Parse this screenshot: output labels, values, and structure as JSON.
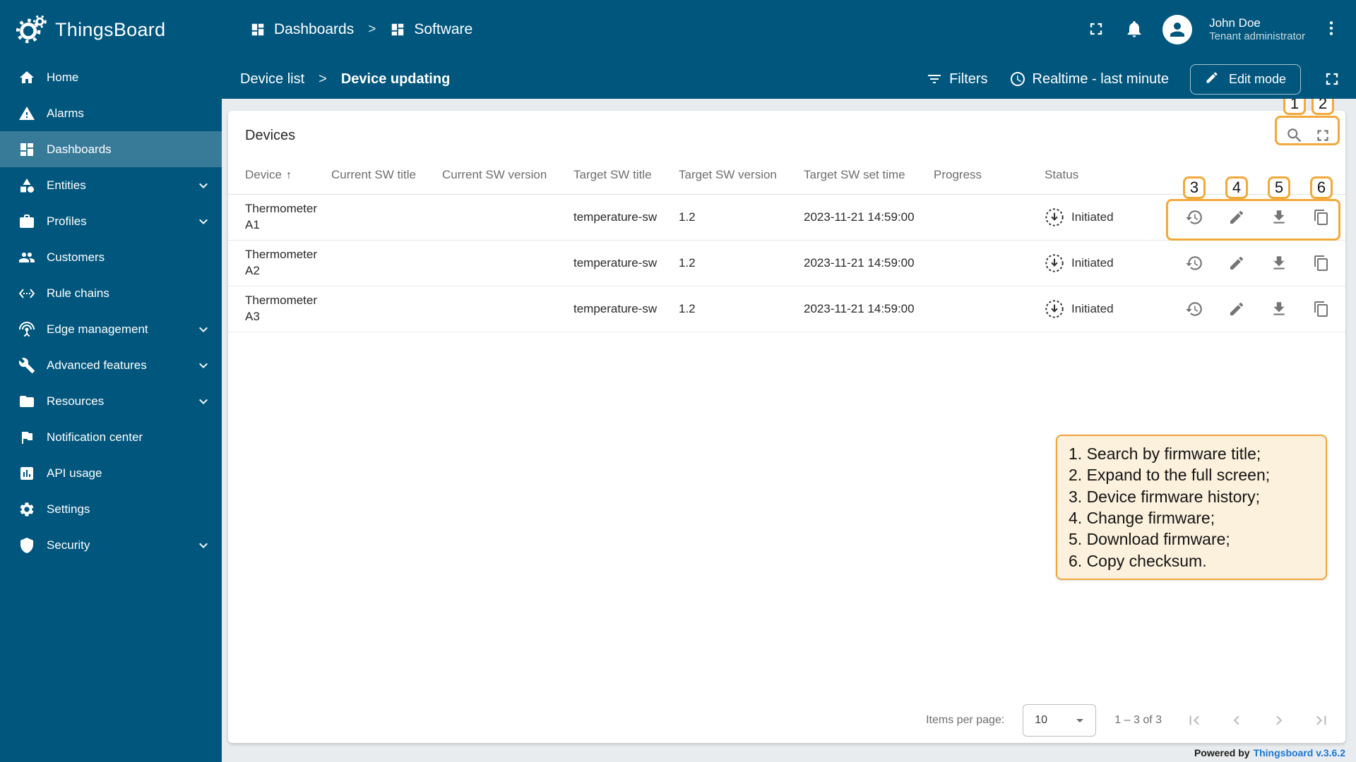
{
  "colors": {
    "primary": "#00567d",
    "annotation_orange": "#f2a93b",
    "legend_bg": "#fcf1dc",
    "link_blue": "#1976d2"
  },
  "brand": {
    "name": "ThingsBoard"
  },
  "topbar": {
    "breadcrumb": [
      {
        "label": "Dashboards"
      },
      {
        "label": "Software"
      }
    ],
    "separator": ">",
    "user": {
      "name": "John Doe",
      "role": "Tenant administrator"
    }
  },
  "sidebar": {
    "items": [
      {
        "label": "Home"
      },
      {
        "label": "Alarms"
      },
      {
        "label": "Dashboards"
      },
      {
        "label": "Entities"
      },
      {
        "label": "Profiles"
      },
      {
        "label": "Customers"
      },
      {
        "label": "Rule chains"
      },
      {
        "label": "Edge management"
      },
      {
        "label": "Advanced features"
      },
      {
        "label": "Resources"
      },
      {
        "label": "Notification center"
      },
      {
        "label": "API usage"
      },
      {
        "label": "Settings"
      },
      {
        "label": "Security"
      }
    ]
  },
  "toolbar": {
    "breadcrumb_root": "Device list",
    "separator": ">",
    "breadcrumb_current": "Device updating",
    "filters_label": "Filters",
    "realtime_label": "Realtime - last minute",
    "edit_mode_label": "Edit mode"
  },
  "devices": {
    "title": "Devices",
    "columns": {
      "device": "Device",
      "current_sw_title": "Current SW title",
      "current_sw_version": "Current SW version",
      "target_sw_title": "Target SW title",
      "target_sw_version": "Target SW version",
      "target_sw_set_time": "Target SW set time",
      "progress": "Progress",
      "status": "Status"
    },
    "sort_arrow": "↑",
    "rows": [
      {
        "device": "Thermometer A1",
        "current_sw_title": "",
        "current_sw_version": "",
        "target_sw_title": "temperature-sw",
        "target_sw_version": "1.2",
        "target_sw_set_time": "2023-11-21 14:59:00",
        "progress": "",
        "status": "Initiated"
      },
      {
        "device": "Thermometer A2",
        "current_sw_title": "",
        "current_sw_version": "",
        "target_sw_title": "temperature-sw",
        "target_sw_version": "1.2",
        "target_sw_set_time": "2023-11-21 14:59:00",
        "progress": "",
        "status": "Initiated"
      },
      {
        "device": "Thermometer A3",
        "current_sw_title": "",
        "current_sw_version": "",
        "target_sw_title": "temperature-sw",
        "target_sw_version": "1.2",
        "target_sw_set_time": "2023-11-21 14:59:00",
        "progress": "",
        "status": "Initiated"
      }
    ]
  },
  "pagination": {
    "items_per_page_label": "Items per page:",
    "items_per_page_value": "10",
    "range_label": "1 – 3 of 3"
  },
  "footer": {
    "powered_by": "Powered by",
    "version": "Thingsboard v.3.6.2"
  },
  "annotations": {
    "badges": [
      "1",
      "2",
      "3",
      "4",
      "5",
      "6"
    ],
    "legend": [
      "1. Search by firmware title;",
      "2. Expand to the full screen;",
      "3. Device firmware history;",
      "4. Change firmware;",
      "5. Download firmware;",
      "6. Copy checksum."
    ]
  },
  "icon_names": [
    "thingsboard-logo-icon",
    "home-icon",
    "alarms-icon",
    "dashboards-icon",
    "entities-icon",
    "profiles-icon",
    "customers-icon",
    "rule-chains-icon",
    "edge-management-icon",
    "advanced-features-icon",
    "resources-icon",
    "notification-center-icon",
    "api-usage-icon",
    "settings-gear-icon",
    "security-shield-icon",
    "chevron-down-icon",
    "fullscreen-icon",
    "bell-icon",
    "avatar-icon",
    "kebab-menu-icon",
    "filter-icon",
    "clock-icon",
    "edit-pencil-icon",
    "search-icon",
    "history-icon",
    "download-icon",
    "copy-icon",
    "status-initiated-icon",
    "dropdown-arrow-icon",
    "first-page-icon",
    "prev-page-icon",
    "next-page-icon",
    "last-page-icon"
  ]
}
